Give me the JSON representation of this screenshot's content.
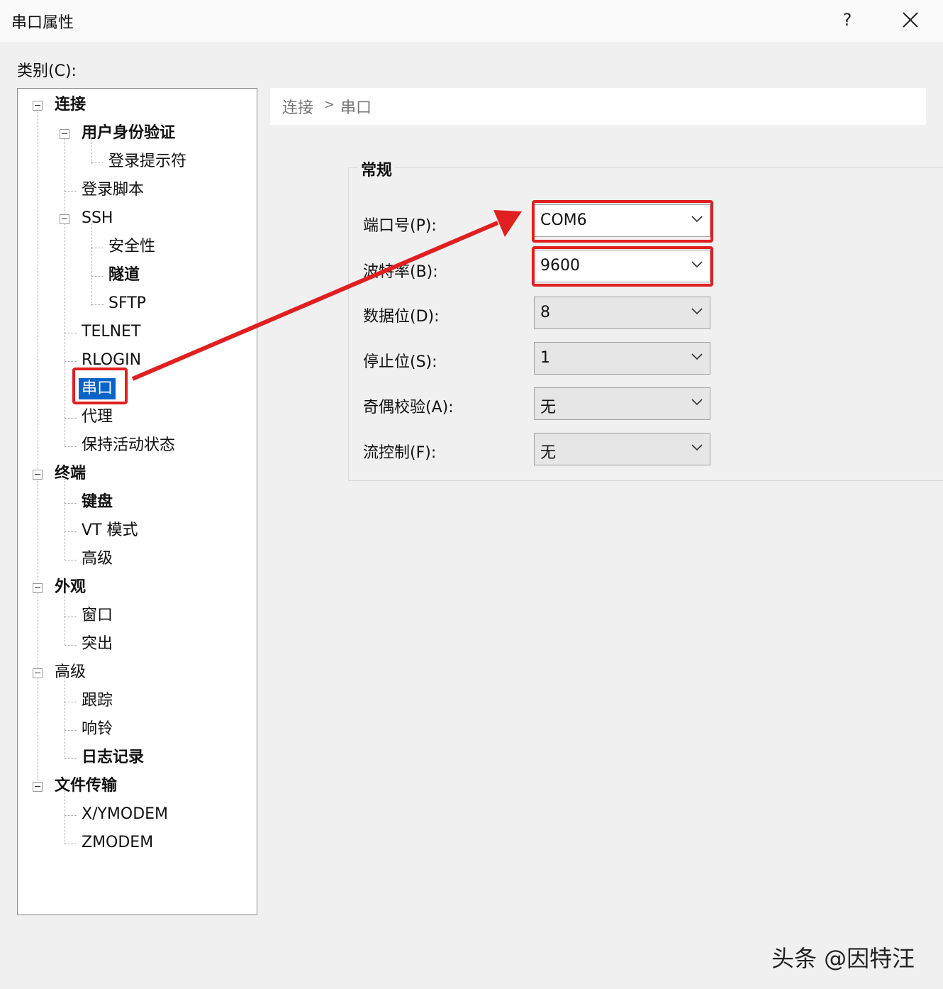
{
  "window": {
    "title": "串口属性",
    "help_label": "?"
  },
  "category_label": "类别(C):",
  "tree": {
    "items": [
      {
        "label": "连接"
      },
      {
        "label": "用户身份验证"
      },
      {
        "label": "登录提示符"
      },
      {
        "label": "登录脚本"
      },
      {
        "label": "SSH"
      },
      {
        "label": "安全性"
      },
      {
        "label": "隧道"
      },
      {
        "label": "SFTP"
      },
      {
        "label": "TELNET"
      },
      {
        "label": "RLOGIN"
      },
      {
        "label": "串口",
        "selected": true
      },
      {
        "label": "代理"
      },
      {
        "label": "保持活动状态"
      },
      {
        "label": "终端"
      },
      {
        "label": "键盘"
      },
      {
        "label": "VT 模式"
      },
      {
        "label": "高级"
      },
      {
        "label": "外观"
      },
      {
        "label": "窗口"
      },
      {
        "label": "突出"
      },
      {
        "label": "高级"
      },
      {
        "label": "跟踪"
      },
      {
        "label": "响铃"
      },
      {
        "label": "日志记录"
      },
      {
        "label": "文件传输"
      },
      {
        "label": "X/YMODEM"
      },
      {
        "label": "ZMODEM"
      }
    ]
  },
  "breadcrumb": {
    "parent": "连接",
    "separator": ">",
    "current": "串口"
  },
  "general": {
    "title": "常规",
    "fields": [
      {
        "label": "端口号(P):",
        "value": "COM6"
      },
      {
        "label": "波特率(B):",
        "value": "9600"
      },
      {
        "label": "数据位(D):",
        "value": "8"
      },
      {
        "label": "停止位(S):",
        "value": "1"
      },
      {
        "label": "奇偶校验(A):",
        "value": "无"
      },
      {
        "label": "流控制(F):",
        "value": "无"
      }
    ]
  },
  "annotation": {
    "color": "#e02020"
  },
  "watermark": "头条 @因特汪"
}
